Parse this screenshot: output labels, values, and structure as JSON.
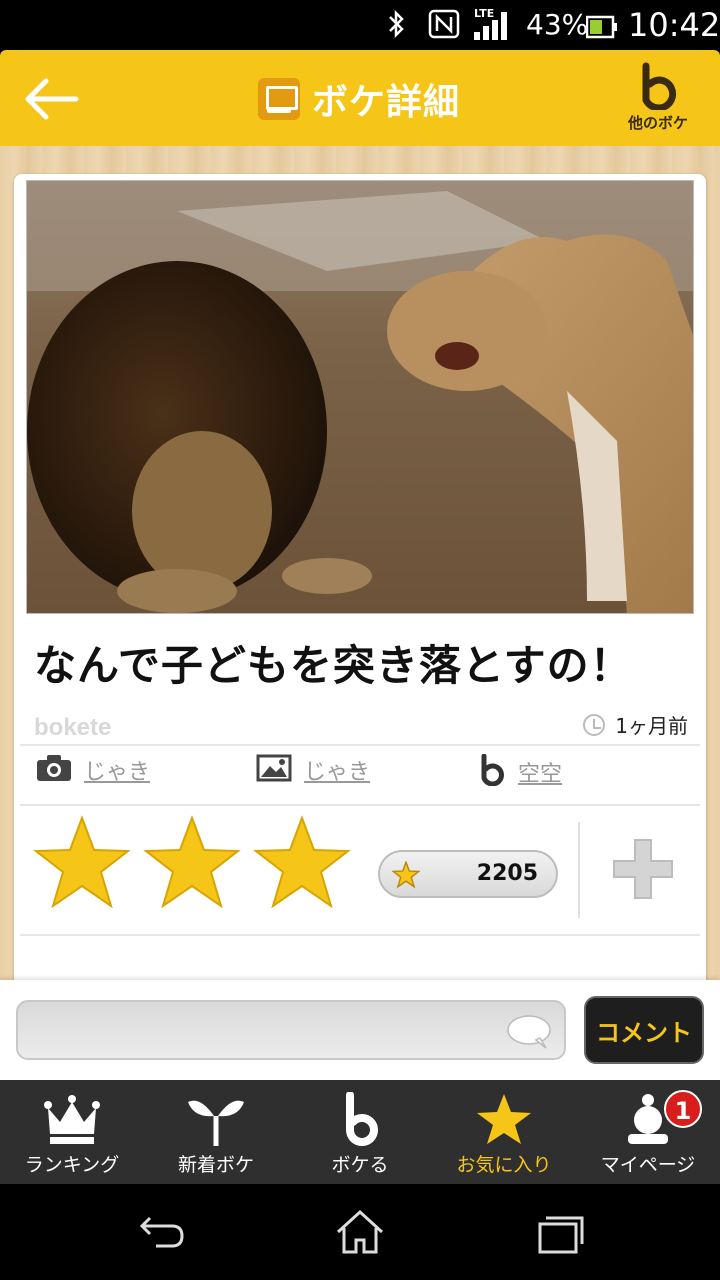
{
  "status_bar": {
    "network": "LTE",
    "battery_percent": "43%",
    "time": "10:42"
  },
  "header": {
    "title": "ボケ詳細",
    "other_boke_label": "他のボケ"
  },
  "post": {
    "caption": "なんで子どもを突き落とすの！",
    "brand": "bokete",
    "posted_ago": "1ヶ月前",
    "photo_author": "じゃき",
    "image_author": "じゃき",
    "boke_author": "空空",
    "star_count": "2205",
    "stars_shown": 3
  },
  "comment_bar": {
    "placeholder": "",
    "button_label": "コメント"
  },
  "tabs": [
    {
      "label": "ランキング",
      "icon": "crown-icon"
    },
    {
      "label": "新着ボケ",
      "icon": "sprout-icon"
    },
    {
      "label": "ボケる",
      "icon": "bokete-b-icon"
    },
    {
      "label": "お気に入り",
      "icon": "star-icon",
      "active": true
    },
    {
      "label": "マイページ",
      "icon": "user-icon",
      "badge": "1"
    }
  ],
  "colors": {
    "accent": "#f5c518",
    "tab_bar": "#2f2f2f",
    "badge": "#d91c1c"
  }
}
